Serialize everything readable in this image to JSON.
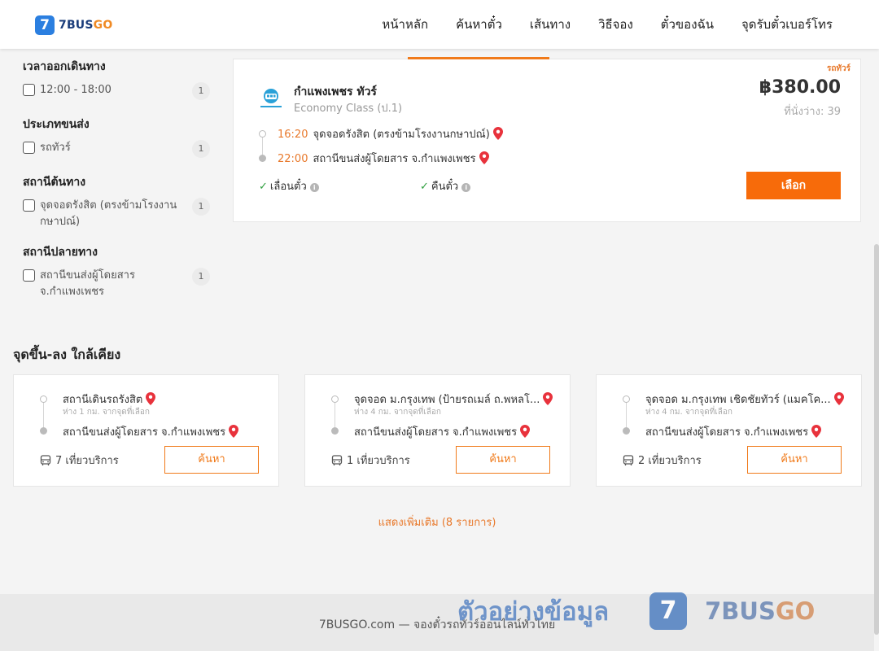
{
  "header": {
    "logo_mark": "7",
    "logo_text_main": "7BUS",
    "logo_text_accent": "GO",
    "nav": [
      "หน้าหลัก",
      "ค้นหาตั๋ว",
      "เส้นทาง",
      "วิธีจอง",
      "ตั๋วของฉัน",
      "จุดรับตั๋วเบอร์โทร"
    ]
  },
  "filters": [
    {
      "title": "เวลาออกเดินทาง",
      "options": [
        {
          "label": "12:00 - 18:00",
          "count": "1",
          "checked": false
        }
      ]
    },
    {
      "title": "ประเภทขนส่ง",
      "options": [
        {
          "label": "รถทัวร์",
          "count": "1",
          "checked": false
        }
      ]
    },
    {
      "title": "สถานีต้นทาง",
      "options": [
        {
          "label": "จุดจอดรังสิต (ตรงข้ามโรงงานกษาปณ์)",
          "count": "1",
          "checked": false
        }
      ]
    },
    {
      "title": "สถานีปลายทาง",
      "options": [
        {
          "label": "สถานีขนส่งผู้โดยสาร จ.กำแพงเพชร",
          "count": "1",
          "checked": false
        }
      ]
    }
  ],
  "trip": {
    "tag": "รถทัวร์",
    "operator": "กำแพงเพชร ทัวร์",
    "class": "Economy Class (ป.1)",
    "price": "฿380.00",
    "seats": "ที่นั่งว่าง: 39",
    "depart_time": "16:20",
    "depart_stop": "จุดจอดรังสิต (ตรงข้ามโรงงานกษาปณ์)",
    "arrive_time": "22:00",
    "arrive_stop": "สถานีขนส่งผู้โดยสาร จ.กำแพงเพชร",
    "option_reschedule": "เลื่อนตั๋ว",
    "option_refund": "คืนตั๋ว",
    "select_label": "เลือก"
  },
  "nearby": {
    "title": "จุดขึ้น-ลง ใกล้เคียง",
    "cards": [
      {
        "from": "สถานีเดินรถรังสิต",
        "distance": "ห่าง 1 กม. จากจุดที่เลือก",
        "to": "สถานีขนส่งผู้โดยสาร จ.กำแพงเพชร",
        "trips": "7 เที่ยวบริการ",
        "button": "ค้นหา"
      },
      {
        "from": "จุดจอด ม.กรุงเทพ (ป้ายรถเมล์ ถ.พหลโ...",
        "distance": "ห่าง 4 กม. จากจุดที่เลือก",
        "to": "สถานีขนส่งผู้โดยสาร จ.กำแพงเพชร",
        "trips": "1 เที่ยวบริการ",
        "button": "ค้นหา"
      },
      {
        "from": "จุดจอด ม.กรุงเทพ เชิดชัยทัวร์ (แมคโค...",
        "distance": "ห่าง 4 กม. จากจุดที่เลือก",
        "to": "สถานีขนส่งผู้โดยสาร จ.กำแพงเพชร",
        "trips": "2 เที่ยวบริการ",
        "button": "ค้นหา"
      }
    ],
    "show_more": "แสดงเพิ่มเติม (8 รายการ)"
  },
  "footer": {
    "text": "7BUSGO.com — จองตั๋วรถทัวร์ออนไลน์ทั่วไทย"
  },
  "watermark": {
    "text": "ตัวอย่างข้อมูล",
    "logo_mark": "7",
    "brand_main": "7BUS",
    "brand_accent": "GO"
  },
  "colors": {
    "accent": "#f76b0a",
    "brand_blue": "#2b7fe0",
    "check_green": "#2e9e3e",
    "pin_red": "#e8323c"
  }
}
